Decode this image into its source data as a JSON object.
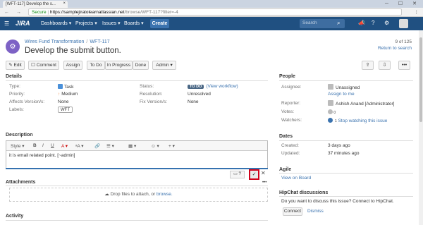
{
  "browser": {
    "tab_title": "[WFT-117] Develop the s...",
    "tab_close": "×",
    "window_controls": "─ ☐ ✕",
    "nav": "← → ⟳",
    "secure": "Secure",
    "url_host": "https://samplejiratolearnatlassian.net",
    "url_path": "/browse/WFT-117?filter=-4",
    "menu": "⋮"
  },
  "jira_nav": {
    "logo": "JIRA",
    "items": [
      "Dashboards ▾",
      "Projects ▾",
      "Issues ▾",
      "Boards ▾"
    ],
    "create": "Create",
    "search_placeholder": "Search"
  },
  "issue": {
    "project": "Wires Fund Transformation",
    "key": "WFT-117",
    "crumb_sep": "/",
    "summary": "Develop the submit button.",
    "pager": "9 of 125",
    "return_to_search": "Return to search"
  },
  "toolbar": {
    "edit": "✎ Edit",
    "comment": "☐ Comment",
    "assign": "Assign",
    "todo": "To Do",
    "in_progress": "In Progress",
    "done": "Done",
    "admin": "Admin ▾"
  },
  "details": {
    "title": "Details",
    "type_label": "Type:",
    "type_value": "Task",
    "priority_label": "Priority:",
    "priority_value": "Medium",
    "affects_label": "Affects Version/s:",
    "affects_value": "None",
    "labels_label": "Labels:",
    "labels_value": "WFT",
    "status_label": "Status:",
    "status_value": "TO DO",
    "view_workflow": "(View workflow)",
    "resolution_label": "Resolution:",
    "resolution_value": "Unresolved",
    "fix_label": "Fix Version/s:",
    "fix_value": "None"
  },
  "description": {
    "title": "Description",
    "style": "Style ▾",
    "bold": "B",
    "italic": "I",
    "underline": "U",
    "color": "A ▾",
    "more_fmt": "ᵃA ▾",
    "link": "🔗",
    "list": "☰ ▾",
    "table": "▦ ▾",
    "emoji": "☺ ▾",
    "plus": "+ ▾",
    "text": "it is email related point. [~admin]",
    "mini_tools": "▭ ?",
    "save": "✓",
    "cancel": "✕"
  },
  "attachments": {
    "title": "Attachments",
    "more": "•••",
    "drop_text": "Drop files to attach, or",
    "browse": "browse."
  },
  "activity": {
    "title": "Activity"
  },
  "people": {
    "title": "People",
    "assignee_label": "Assignee:",
    "assignee_value": "Unassigned",
    "assign_to_me": "Assign to me",
    "reporter_label": "Reporter:",
    "reporter_value": "Ashish Anand [Administrator]",
    "votes_label": "Votes:",
    "votes_value": "0",
    "watchers_label": "Watchers:",
    "watchers_count": "1",
    "stop_watching": "Stop watching this issue"
  },
  "dates": {
    "title": "Dates",
    "created_label": "Created:",
    "created_value": "3 days ago",
    "updated_label": "Updated:",
    "updated_value": "37 minutes ago"
  },
  "agile": {
    "title": "Agile",
    "view_on_board": "View on Board"
  },
  "hipchat": {
    "title": "HipChat discussions",
    "text": "Do you want to discuss this issue? Connect to HipChat.",
    "connect": "Connect",
    "dismiss": "Dismiss"
  }
}
